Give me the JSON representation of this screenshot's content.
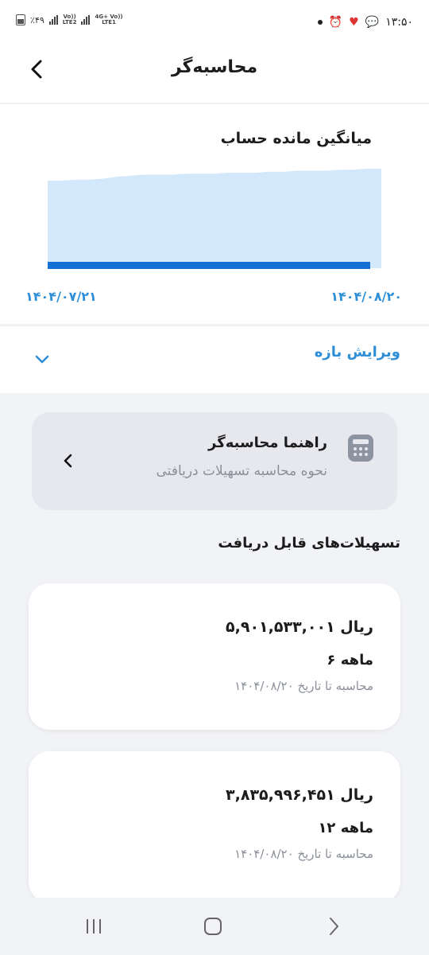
{
  "status_bar": {
    "battery_text": "٪۴۹",
    "net1_top": "Vo))",
    "net1_bottom": "LTE2",
    "net2_top": "4G+ Vo))",
    "net2_bottom": "LTE1",
    "time": "۱۳:۵۰"
  },
  "header": {
    "title": "محاسبه‌گر"
  },
  "chart": {
    "title": "میانگین مانده حساب",
    "start_date": "۱۴۰۴/۰۷/۲۱",
    "end_date": "۱۴۰۴/۰۸/۲۰"
  },
  "chart_data": {
    "type": "area",
    "title": "میانگین مانده حساب",
    "x_start": "۱۴۰۴/۰۷/۲۱",
    "x_end": "۱۴۰۴/۰۸/۲۰",
    "fill_color": "#d3e9fb",
    "line_color": "#1570d6",
    "series": [
      {
        "values": [
          0.88,
          0.88,
          0.89,
          0.89,
          0.9,
          0.92,
          0.93,
          0.94,
          0.94,
          0.94,
          0.95,
          0.95,
          0.95,
          0.96,
          0.96,
          0.96,
          0.97,
          0.97,
          0.98,
          0.98,
          0.98,
          0.99,
          0.99,
          1.0,
          1.0
        ]
      }
    ]
  },
  "edit": {
    "label": "ویرایش بازه"
  },
  "guide": {
    "title": "راهنما محاسبه‌گر",
    "subtitle": "نحوه محاسبه تسهیلات دریافتی"
  },
  "section": {
    "title": "تسهیلات‌های قابل دریافت"
  },
  "loans": [
    {
      "amount": "۵,۹۰۱,۵۳۳,۰۰۱ ریال",
      "term": "۶ ماهه",
      "date": "محاسبه تا تاریخ ۱۴۰۴/۰۸/۲۰"
    },
    {
      "amount": "۳,۸۳۵,۹۹۶,۴۵۱ ریال",
      "term": "۱۲ ماهه",
      "date": "محاسبه تا تاریخ ۱۴۰۴/۰۸/۲۰"
    }
  ],
  "colors": {
    "accent": "#2f8fd6",
    "background": "#f2f3f7",
    "card": "#ffffff"
  }
}
